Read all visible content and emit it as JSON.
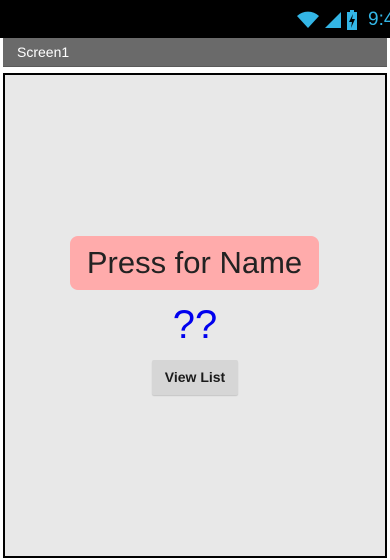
{
  "status_bar": {
    "time": "9:4",
    "wifi_icon": "wifi-icon",
    "signal_icon": "cellular-signal-icon",
    "battery_icon": "battery-charging-icon",
    "icon_color": "#33b5e5"
  },
  "title_bar": {
    "title": "Screen1",
    "color": "#6a6a6a"
  },
  "main": {
    "name_button_label": "Press for Name",
    "name_button_color": "#ffabab",
    "name_display": "??",
    "name_display_color": "#0000ee",
    "view_list_button_label": "View List"
  }
}
